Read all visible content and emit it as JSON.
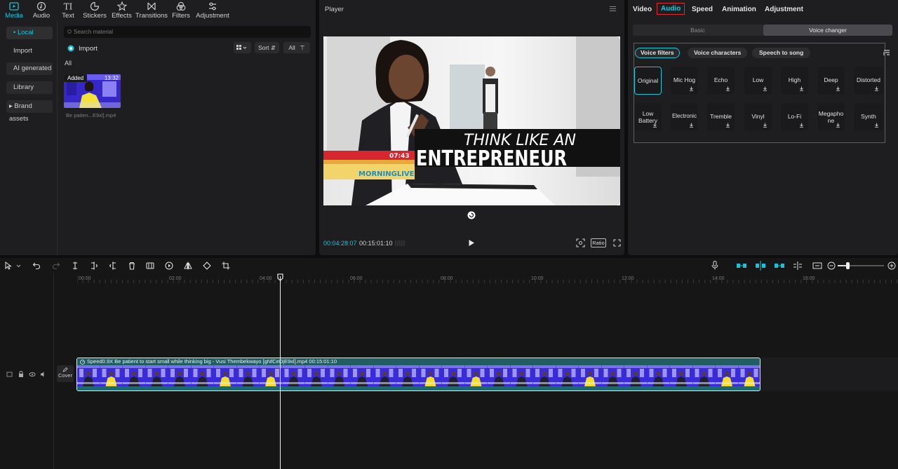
{
  "media_tabs": [
    {
      "label": "Media",
      "icon": "media-icon",
      "active": true
    },
    {
      "label": "Audio",
      "icon": "audio-icon"
    },
    {
      "label": "Text",
      "icon": "text-icon"
    },
    {
      "label": "Stickers",
      "icon": "stickers-icon"
    },
    {
      "label": "Effects",
      "icon": "effects-icon"
    },
    {
      "label": "Transitions",
      "icon": "transitions-icon"
    },
    {
      "label": "Filters",
      "icon": "filters-icon"
    },
    {
      "label": "Adjustment",
      "icon": "adjustment-icon"
    }
  ],
  "left_nav": {
    "local": "• Local",
    "import": "Import",
    "ai_generated": "AI generated",
    "library": "Library",
    "brand_assets": "▸ Brand assets"
  },
  "media": {
    "search_placeholder": "Search material",
    "import_label": "Import",
    "sort_label": "Sort",
    "all_filter": "All",
    "section_all": "All",
    "clip": {
      "badge": "Added",
      "duration": "13:32",
      "name": "Be patien...E9xl].mp4"
    }
  },
  "player": {
    "title": "Player",
    "current_time": "00:04:28:07",
    "total_time": "00:15:01:10",
    "ratio_label": "Ratio",
    "video_overlay": {
      "line1": "THINK LIKE AN",
      "line2": "ENTREPRENEUR",
      "clock": "07:43",
      "logo": "MORNINGLIVE"
    }
  },
  "right_panel": {
    "tabs": [
      "Video",
      "Audio",
      "Speed",
      "Animation",
      "Adjustment"
    ],
    "active_tab": "Audio",
    "subtabs": {
      "basic": "Basic",
      "voice_changer": "Voice changer"
    },
    "filter_tabs": [
      "Voice filters",
      "Voice characters",
      "Speech to song"
    ],
    "voice_filters": [
      "Original",
      "Mic Hog",
      "Echo",
      "Low",
      "High",
      "Deep",
      "Distorted",
      "Low Battery",
      "Electronic",
      "Tremble",
      "Vinyl",
      "Lo-Fi",
      "Megaphone",
      "Synth"
    ]
  },
  "timeline": {
    "ticks": [
      "00:00",
      "02:00",
      "04:00",
      "06:00",
      "08:00",
      "10:00",
      "12:00",
      "14:00",
      "16:00"
    ],
    "cover_label": "Cover",
    "clip_title": "Speed0.9X  Be patient to start small while thinking big - Vusi Thembekwayo [gNfCeDjE9xl].mp4  00:15:01:10"
  },
  "colors": {
    "accent": "#19c3d6",
    "highlight_red": "#e0262f",
    "panel": "#1e1e20",
    "clip_purple": "#3b2bd6"
  }
}
